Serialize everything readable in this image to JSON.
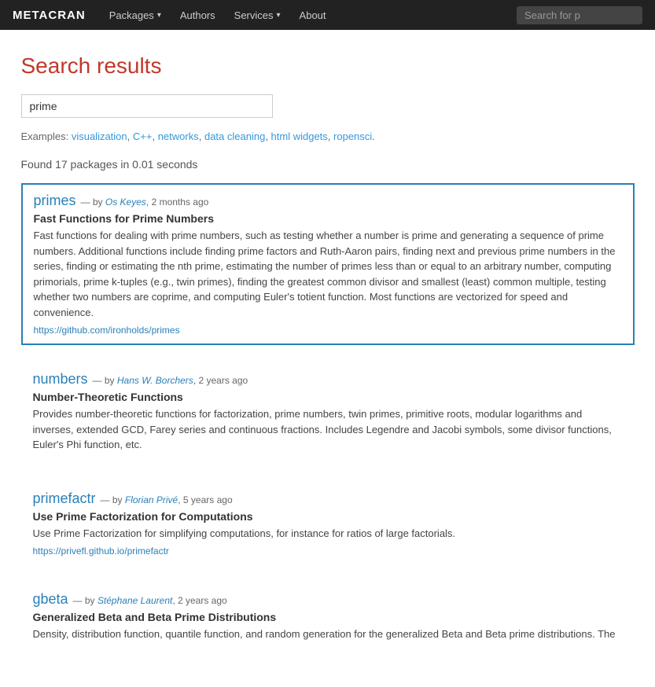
{
  "navbar": {
    "brand": "METACRAN",
    "items": [
      {
        "label": "Packages",
        "has_dropdown": true
      },
      {
        "label": "Authors",
        "has_dropdown": false
      },
      {
        "label": "Services",
        "has_dropdown": true
      },
      {
        "label": "About",
        "has_dropdown": false
      }
    ],
    "search_placeholder": "Search for p"
  },
  "page": {
    "title": "Search results",
    "search_value": "prime",
    "examples_prefix": "Examples:",
    "examples": [
      {
        "label": "visualization",
        "url": "#"
      },
      {
        "label": "C++",
        "url": "#"
      },
      {
        "label": "networks",
        "url": "#"
      },
      {
        "label": "data cleaning",
        "url": "#"
      },
      {
        "label": "html widgets",
        "url": "#"
      },
      {
        "label": "ropensci",
        "url": "#"
      }
    ],
    "results_summary": "Found 17 packages in 0.01 seconds"
  },
  "packages": [
    {
      "name": "primes",
      "meta_by": "— by",
      "author": "Os Keyes",
      "age": "2 months ago",
      "title": "Fast Functions for Prime Numbers",
      "description": "Fast functions for dealing with prime numbers, such as testing whether a number is prime and generating a sequence of prime numbers. Additional functions include finding prime factors and Ruth-Aaron pairs, finding next and previous prime numbers in the series, finding or estimating the nth prime, estimating the number of primes less than or equal to an arbitrary number, computing primorials, prime k-tuples (e.g., twin primes), finding the greatest common divisor and smallest (least) common multiple, testing whether two numbers are coprime, and computing Euler's totient function. Most functions are vectorized for speed and convenience.",
      "url": "https://github.com/ironholds/primes",
      "highlighted": true
    },
    {
      "name": "numbers",
      "meta_by": "— by",
      "author": "Hans W. Borchers",
      "age": "2 years ago",
      "title": "Number-Theoretic Functions",
      "description": "Provides number-theoretic functions for factorization, prime numbers, twin primes, primitive roots, modular logarithms and inverses, extended GCD, Farey series and continuous fractions. Includes Legendre and Jacobi symbols, some divisor functions, Euler's Phi function, etc.",
      "url": "",
      "highlighted": false
    },
    {
      "name": "primefactr",
      "meta_by": "— by",
      "author": "Florian Privé",
      "age": "5 years ago",
      "title": "Use Prime Factorization for Computations",
      "description": "Use Prime Factorization for simplifying computations, for instance for ratios of large factorials.",
      "url": "https://privefl.github.io/primefactr",
      "highlighted": false
    },
    {
      "name": "gbeta",
      "meta_by": "— by",
      "author": "Stéphane Laurent",
      "age": "2 years ago",
      "title": "Generalized Beta and Beta Prime Distributions",
      "description": "Density, distribution function, quantile function, and random generation for the generalized Beta and Beta prime distributions. The",
      "url": "",
      "highlighted": false
    }
  ]
}
